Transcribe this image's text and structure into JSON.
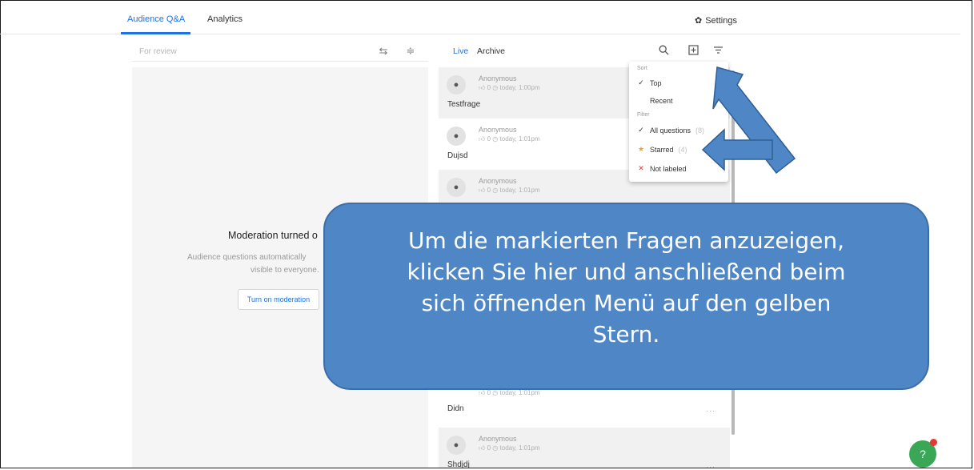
{
  "header": {
    "tabs": [
      {
        "label": "Audience Q&A",
        "active": true
      },
      {
        "label": "Analytics",
        "active": false
      }
    ],
    "settings_label": "Settings"
  },
  "left": {
    "filter_label": "For review",
    "moderation_title": "Moderation turned o",
    "moderation_line1": "Audience questions automatically",
    "moderation_line2": "visible to everyone.",
    "moderation_button": "Turn on moderation"
  },
  "right": {
    "tabs": {
      "live": "Live",
      "archive": "Archive"
    },
    "questions": [
      {
        "author": "Anonymous",
        "likes": "0",
        "time": "today, 1:00pm",
        "text": "Testfrage"
      },
      {
        "author": "Anonymous",
        "likes": "0",
        "time": "today, 1:01pm",
        "text": "Dujsd"
      },
      {
        "author": "Anonymous",
        "likes": "0",
        "time": "today, 1:01pm",
        "text": ""
      },
      {
        "author": "",
        "likes": "0",
        "time": "today, 1:01pm",
        "text": "Didn"
      },
      {
        "author": "Anonymous",
        "likes": "0",
        "time": "today, 1:01pm",
        "text": "Shdjdj"
      }
    ]
  },
  "menu": {
    "sort_label": "Sort",
    "top": "Top",
    "recent": "Recent",
    "filter_label": "Filter",
    "all_questions": "All questions",
    "all_count": "(8)",
    "starred": "Starred",
    "starred_count": "(4)",
    "not_labeled": "Not labeled"
  },
  "callout": {
    "line1": "Um die markierten Fragen anzuzeigen,",
    "line2": "klicken Sie hier und anschließend beim",
    "line3": "sich öffnenden Menü auf den gelben",
    "line4": "Stern."
  },
  "colors": {
    "accent": "#1a73e8",
    "callout": "#4f86c6",
    "help_button": "#3aa757",
    "star": "#f4a31e",
    "not_labeled": "#e53935"
  },
  "icons": [
    "settings-gear-icon",
    "megaphone-icon",
    "sliders-icon",
    "search-icon",
    "present-icon",
    "filter-icon",
    "person-icon",
    "thumb-up-icon",
    "clock-icon",
    "check-icon",
    "star-icon",
    "x-icon",
    "help-icon"
  ]
}
